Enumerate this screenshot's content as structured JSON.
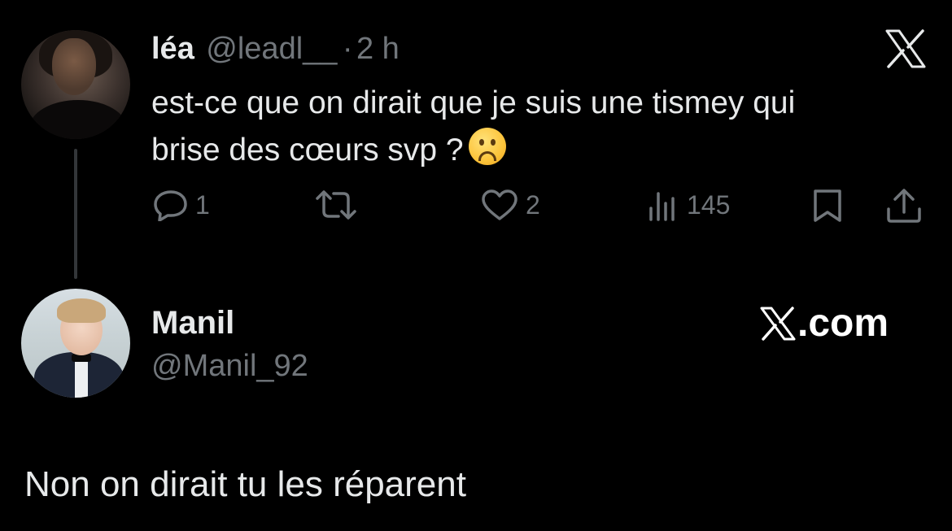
{
  "original_tweet": {
    "author_name": "léa",
    "author_handle": "@leadl__",
    "separator": "·",
    "time_ago": "2 h",
    "text_line1": "est-ce que on dirait que je suis une tismey qui",
    "text_line2": "brise des cœurs svp ?",
    "emoji": "frowning-face",
    "actions": {
      "replies": "1",
      "retweets": "",
      "likes": "2",
      "views": "145"
    }
  },
  "reply": {
    "author_name": "Manil",
    "author_handle": "@Manil_92",
    "text": "Non on dirait tu les réparent"
  },
  "watermark": {
    "text": ".com"
  },
  "icons": {
    "top_right": "x-logo-icon",
    "reply": "reply-icon",
    "retweet": "retweet-icon",
    "like": "heart-icon",
    "views": "views-icon",
    "bookmark": "bookmark-icon",
    "share": "share-icon"
  },
  "colors": {
    "background": "#000000",
    "text": "#e7e9ea",
    "secondary": "#71767b",
    "thread_line": "#333639"
  }
}
